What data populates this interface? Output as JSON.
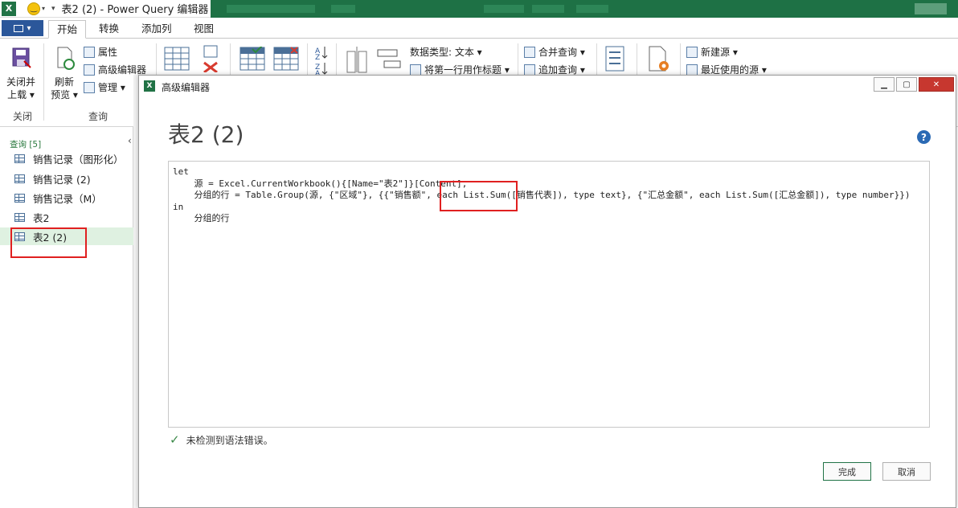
{
  "window": {
    "title": "表2 (2) - Power Query 编辑器",
    "excel_icon": "X"
  },
  "ribbon_tabs": [
    {
      "label": "开始",
      "active": true
    },
    {
      "label": "转换",
      "active": false
    },
    {
      "label": "添加列",
      "active": false
    },
    {
      "label": "视图",
      "active": false
    }
  ],
  "ribbon": {
    "close_group": {
      "button": "关闭并",
      "button2": "上载 ▾",
      "label": "关闭"
    },
    "query_group": {
      "refresh": "刷新",
      "refresh2": "预览 ▾",
      "properties": "属性",
      "advanced_editor": "高级编辑器",
      "manage": "管理 ▾",
      "label": "查询"
    },
    "data_type": "数据类型: 文本 ▾",
    "first_row_header": "将第一行用作标题 ▾",
    "merge_queries": "合并查询 ▾",
    "append_queries": "追加查询 ▾",
    "new_source": "新建源 ▾",
    "recent_sources": "最近使用的源 ▾"
  },
  "navigator": {
    "header": "查询 [5]",
    "items": [
      {
        "label": "销售记录（图形化）"
      },
      {
        "label": "销售记录 (2)"
      },
      {
        "label": "销售记录（M）"
      },
      {
        "label": "表2"
      },
      {
        "label": "表2 (2)",
        "selected": true
      }
    ]
  },
  "dialog": {
    "title": "高级编辑器",
    "heading": "表2 (2)",
    "code": "let\n    源 = Excel.CurrentWorkbook(){[Name=\"表2\"]}[Content],\n    分组的行 = Table.Group(源, {\"区域\"}, {{\"销售额\", each List.Sum([销售代表]), type text}, {\"汇总金额\", each List.Sum([汇总金额]), type number}})\nin\n    分组的行",
    "status": "未检测到语法错误。",
    "ok_button": "完成",
    "cancel_button": "取消"
  },
  "colors": {
    "excel_green": "#217346",
    "highlight_red": "#e02020",
    "selected_row": "#dff1e1"
  }
}
